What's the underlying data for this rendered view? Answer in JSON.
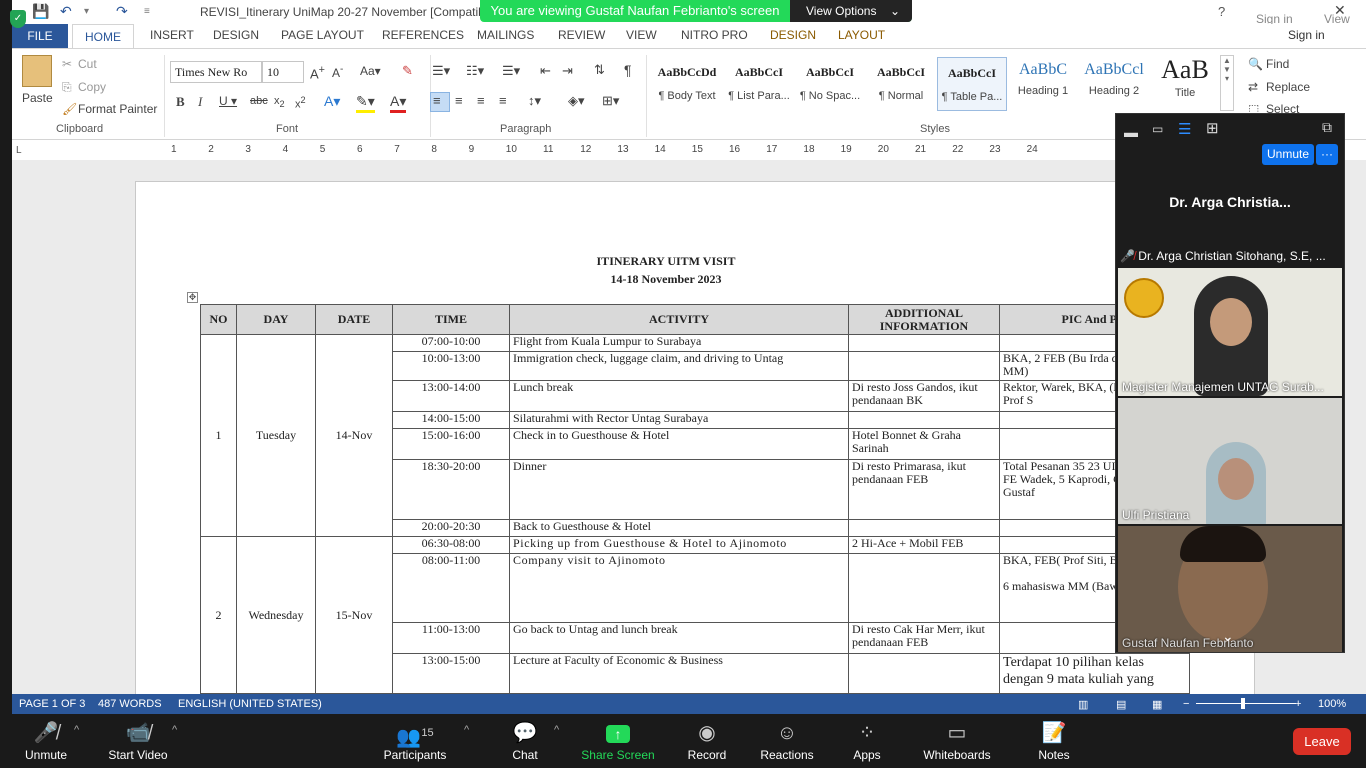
{
  "word": {
    "title": "REVISI_Itinerary UniMap 20-27 November [Compatibili",
    "top_right": {
      "help": "?",
      "sign_in": "Sign in",
      "view": "View"
    },
    "tabs": [
      "FILE",
      "HOME",
      "INSERT",
      "DESIGN",
      "PAGE LAYOUT",
      "REFERENCES",
      "MAILINGS",
      "REVIEW",
      "VIEW",
      "NITRO PRO",
      "DESIGN",
      "LAYOUT"
    ],
    "sign_in": "Sign in",
    "clipboard": {
      "paste": "Paste",
      "cut": "Cut",
      "copy": "Copy",
      "format_painter": "Format Painter",
      "group": "Clipboard"
    },
    "font": {
      "name": "Times New Ro",
      "size": "10",
      "group": "Font"
    },
    "paragraph": {
      "group": "Paragraph"
    },
    "styles": {
      "group": "Styles",
      "items": [
        {
          "preview": "AaBbCcDd",
          "label": "¶ Body Text"
        },
        {
          "preview": "AaBbCcI",
          "label": "¶ List Para..."
        },
        {
          "preview": "AaBbCcI",
          "label": "¶ No Spac..."
        },
        {
          "preview": "AaBbCcI",
          "label": "¶ Normal"
        },
        {
          "preview": "AaBbCcI",
          "label": "¶ Table Pa..."
        },
        {
          "preview": "AaBbC",
          "label": "Heading 1"
        },
        {
          "preview": "AaBbCcl",
          "label": "Heading 2"
        },
        {
          "preview": "AaB",
          "label": "Title"
        }
      ]
    },
    "editing": {
      "find": "Find",
      "replace": "Replace",
      "select": "Select"
    },
    "ruler": [
      "1",
      "2",
      "3",
      "4",
      "5",
      "6",
      "7",
      "8",
      "9",
      "10",
      "11",
      "12",
      "13",
      "14",
      "15",
      "16",
      "17",
      "18",
      "19",
      "20",
      "21",
      "22",
      "23",
      "24"
    ],
    "status": {
      "page": "PAGE 1 OF 3",
      "words": "487 WORDS",
      "lang": "ENGLISH (UNITED STATES)",
      "zoom": "100%"
    }
  },
  "doc": {
    "title": "ITINERARY UITM VISIT",
    "dates": "14-18 November 2023",
    "headers": [
      "NO",
      "DAY",
      "DATE",
      "TIME",
      "ACTIVITY",
      "ADDITIONAL INFORMATION",
      "PIC And Per"
    ],
    "day1": {
      "no": "1",
      "day": "Tuesday",
      "date": "14-Nov",
      "rows": [
        {
          "time": "07:00-10:00",
          "activity": "Flight from Kuala Lumpur to Surabaya",
          "info": "",
          "pic": ""
        },
        {
          "time": "10:00-13:00",
          "activity": "Immigration check, luggage claim, and driving to Untag",
          "info": "",
          "pic": "BKA, 2 FEB (Bu Irda d Rizai Mhs MM)"
        },
        {
          "time": "13:00-14:00",
          "activity": "Lunch break",
          "info": "Di resto Joss Gandos, ikut pendanaan BK",
          "pic": "Rektor, Warek, BKA, (Dekan,Wadek, Prof S"
        },
        {
          "time": "14:00-15:00",
          "activity": "Silaturahmi with Rector Untag Surabaya",
          "info": "",
          "pic": ""
        },
        {
          "time": "15:00-16:00",
          "activity": "Check in to Guesthouse & Hotel",
          "info": "Hotel Bonnet & Graha Sarinah",
          "pic": ""
        },
        {
          "time": "18:30-20:00",
          "activity": "Dinner",
          "info": "Di resto Primarasa, ikut pendanaan FEB",
          "pic": "Total Pesanan 35 23 UITM, 2 BKA, FE Wadek, 5 Kaprodi, G akuntansi, Gustaf"
        },
        {
          "time": "20:00-20:30",
          "activity": "Back to Guesthouse & Hotel",
          "info": "",
          "pic": ""
        }
      ]
    },
    "day2": {
      "no": "2",
      "day": "Wednesday",
      "date": "15-Nov",
      "rows": [
        {
          "time": "06:30-08:00",
          "activity": "Picking up from Guesthouse & Hotel to Ajinomoto",
          "info": "2 Hi-Ace + Mobil FEB",
          "pic": ""
        },
        {
          "time": "08:00-11:00",
          "activity": "Company visit to Ajinomoto",
          "info": "",
          "pic": "BKA, FEB( Prof Siti, B Ardi, Gustaf)",
          "pic2": "6 mahasiswa MM (Baw sendiri)"
        },
        {
          "time": "11:00-13:00",
          "activity": "Go back to Untag and lunch break",
          "info": "Di resto Cak Har Merr, ikut pendanaan FEB",
          "pic": ""
        },
        {
          "time": "13:00-15:00",
          "activity": "Lecture at Faculty of Economic & Business",
          "info": "",
          "pic": "Terdapat 10 pilihan kelas dengan 9 mata kuliah yang"
        }
      ]
    }
  },
  "zoom": {
    "banner": "You are viewing Gustaf Naufan Febrianto's screen",
    "view_options": "View Options",
    "unmute_btn": "Unmute",
    "more": "···",
    "speaker_label": "Dr. Arga Christia...",
    "participants": [
      {
        "name": "Dr. Arga Christian Sitohang, S.E, ..."
      },
      {
        "name": "Magister Manajemen UNTAG Surab..."
      },
      {
        "name": "Ulfi Pristiana"
      },
      {
        "name": "Gustaf Naufan Febrianto"
      }
    ],
    "toolbar": [
      {
        "label": "Unmute"
      },
      {
        "label": "Start Video"
      },
      {
        "label": "Participants",
        "count": "15"
      },
      {
        "label": "Chat"
      },
      {
        "label": "Share Screen"
      },
      {
        "label": "Record"
      },
      {
        "label": "Reactions"
      },
      {
        "label": "Apps"
      },
      {
        "label": "Whiteboards"
      },
      {
        "label": "Notes"
      }
    ],
    "leave": "Leave",
    "colors": {
      "share": "#23d959",
      "leave": "#d93025",
      "word_blue": "#2b579a"
    }
  }
}
